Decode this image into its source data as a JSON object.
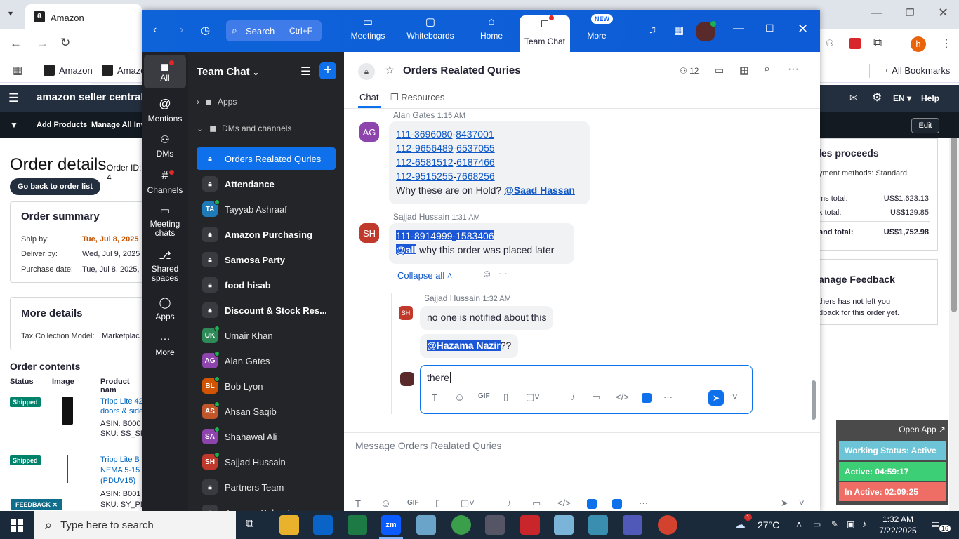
{
  "chrome": {
    "tab_title": "Amazon",
    "url_partial": "sellerce",
    "bookmarks": [
      "Amazon",
      "Amazo"
    ],
    "all_bookmarks": "All Bookmarks",
    "profile_initial": "h"
  },
  "amazon": {
    "logo": "amazon seller central",
    "nav_right": [
      "EN ▾",
      "Help"
    ],
    "subnav": [
      "Add Products",
      "Manage All Inve"
    ],
    "edit": "Edit",
    "order_title": "Order details",
    "order_id_label": "Order ID: 4",
    "back_button": "Go back to order list",
    "order_summary": "Order summary",
    "ship_by_label": "Ship by:",
    "ship_by_value": "Tue, Jul 8, 2025",
    "deliver_by_label": "Deliver by:",
    "deliver_by_value": "Wed, Jul 9, 2025",
    "purchase_label": "Purchase date:",
    "purchase_value": "Tue, Jul 8, 2025,",
    "more_details": "More details",
    "tax_label": "Tax Collection Model:",
    "tax_value": "Marketplac",
    "order_contents": "Order contents",
    "cols": [
      "Status",
      "Image",
      "Product nam"
    ],
    "rows": [
      {
        "status": "Shipped",
        "product": "Tripp Lite 42",
        "product2": "doors & side",
        "asin": "ASIN: B000",
        "sku": "SKU: SS_SR"
      },
      {
        "status": "Shipped",
        "product": "Tripp Lite B",
        "product2": "NEMA 5-15",
        "product3": "(PDUV15)",
        "asin": "ASIN: B001",
        "sku": "SKU: SY_PD"
      }
    ],
    "feedback_tab": "FEEDBACK ✕",
    "proceeds_title": "les proceeds",
    "payment_methods": "yment methods: Standard",
    "items_total_label": "ms total:",
    "items_total": "US$1,623.13",
    "tax_total_label": "x total:",
    "tax_total": "US$129.85",
    "grand_total_label": "and total:",
    "grand_total": "US$1,752.98",
    "feedback_title": "anage Feedback",
    "feedback_text1": "thers has not left you",
    "feedback_text2": "dback for this order yet."
  },
  "zoom": {
    "search_label": "Search",
    "search_shortcut": "Ctrl+F",
    "top_tabs": [
      {
        "label": "Meetings"
      },
      {
        "label": "Whiteboards"
      },
      {
        "label": "Home"
      },
      {
        "label": "Team Chat"
      },
      {
        "label": "More",
        "badge": "NEW"
      }
    ],
    "rail": [
      "All",
      "Mentions",
      "DMs",
      "Channels",
      "Meeting chats",
      "Shared spaces",
      "Apps",
      "More"
    ],
    "sidebar_title": "Team Chat",
    "apps_label": "Apps",
    "dms_channels_label": "DMs and channels",
    "sidebar_items": [
      {
        "label": "Orders Realated Quries",
        "type": "lock",
        "active": true
      },
      {
        "label": "Attendance",
        "type": "lock",
        "bold": true
      },
      {
        "label": "Tayyab Ashraaf",
        "type": "avatar",
        "initials": "TA",
        "color": "#1f7ab8"
      },
      {
        "label": "Amazon Purchasing",
        "type": "lock",
        "bold": true
      },
      {
        "label": "Samosa Party",
        "type": "lock",
        "bold": true
      },
      {
        "label": "food hisab",
        "type": "lock",
        "bold": true
      },
      {
        "label": "Discount & Stock Res...",
        "type": "lock",
        "bold": true
      },
      {
        "label": "Umair Khan",
        "type": "avatar",
        "initials": "UK",
        "color": "#2e8b57"
      },
      {
        "label": "Alan Gates",
        "type": "avatar",
        "initials": "AG",
        "color": "#8e44ad"
      },
      {
        "label": "Bob Lyon",
        "type": "avatar",
        "initials": "BL",
        "color": "#d35400"
      },
      {
        "label": "Ahsan Saqib",
        "type": "avatar",
        "initials": "AS",
        "color": "#c0562a"
      },
      {
        "label": "Shahawal Ali",
        "type": "avatar",
        "initials": "SA",
        "color": "#8e44ad"
      },
      {
        "label": "Sajjad Hussain",
        "type": "avatar",
        "initials": "SH",
        "color": "#c0392b"
      },
      {
        "label": "Partners Team",
        "type": "lock"
      },
      {
        "label": "Amazon Sales Team",
        "type": "lock"
      }
    ],
    "channel_title": "Orders Realated Quries",
    "member_count": "12",
    "chat_tab": "Chat",
    "resources_tab": "Resources",
    "msg1_author": "Alan Gates",
    "msg1_time": "1:15 AM",
    "msg1_initials": "AG",
    "msg1_lines": [
      [
        "111-3696080",
        "8437001"
      ],
      [
        "112-9656489",
        "6537055"
      ],
      [
        "112-6581512",
        "6187466"
      ],
      [
        "112-9515255",
        "7668256"
      ]
    ],
    "msg1_text": "Why these are on Hold? ",
    "msg1_mention": "@Saad Hassan",
    "msg2_author": "Sajjad Hussain",
    "msg2_time": "1:31 AM",
    "msg2_initials": "SH",
    "msg2_order_a": "111-8914999",
    "msg2_order_b": "1583406",
    "msg2_mention": "@all",
    "msg2_text": " why this order was placed later",
    "collapse_all": "Collapse all",
    "reply_author": "Sajjad Hussain",
    "reply_time": "1:32 AM",
    "reply_initials": "SH",
    "reply1": "no one is notified about this",
    "reply2_mention": "@Hazama Nazir",
    "reply2_suffix": "??",
    "composer_text": "there ",
    "main_placeholder": "Message Orders Realated Quries"
  },
  "work_status": {
    "open_app": "Open App ↗",
    "status": "Working Status: Active",
    "active": "Active: 04:59:17",
    "inactive": "In Active: 02:09:25"
  },
  "taskbar": {
    "search_placeholder": "Type here to search",
    "temperature": "27°C",
    "weather_badge": "1",
    "time": "1:32 AM",
    "date": "7/22/2025",
    "notif_count": "16"
  }
}
